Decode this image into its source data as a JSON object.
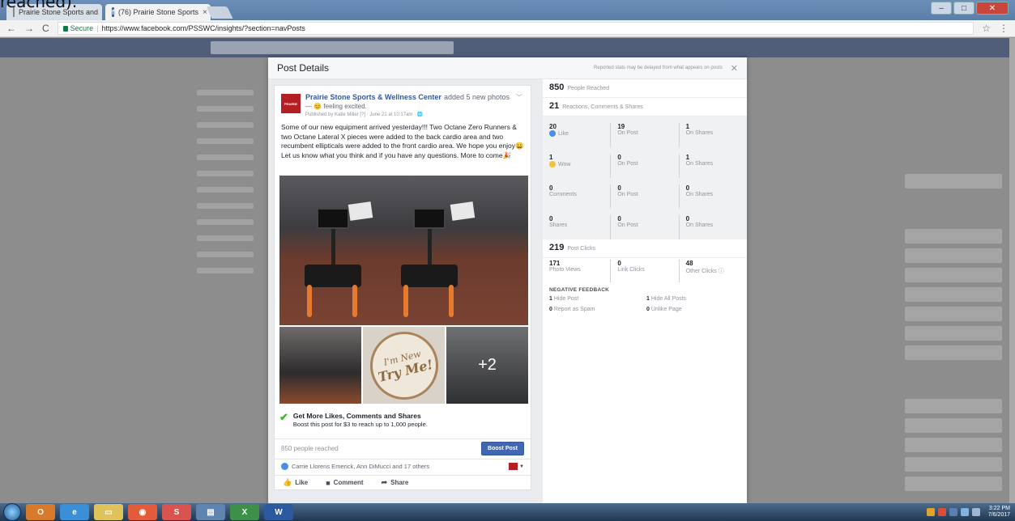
{
  "top_caption": "reached).",
  "browser": {
    "tabs": [
      {
        "title": "Prairie Stone Sports and",
        "active": false
      },
      {
        "title": "(76) Prairie Stone Sports",
        "active": true
      }
    ],
    "secure_label": "Secure",
    "url": "https://www.facebook.com/PSSWC/insights/?section=navPosts"
  },
  "modal": {
    "title": "Post Details",
    "note": "Reported stats may be delayed from what appears on posts"
  },
  "post": {
    "page_name": "Prairie Stone Sports & Wellness Center",
    "added_text": "added 5 new photos",
    "feeling": "— 😊 feeling excited.",
    "published": "Published by Katie Miller [?] · June 21 at 10:17am · 🌐",
    "body": "Some of our new equipment arrived yesterday!!! Two Octane Zero Runners & two Octane Lateral X pieces were added to the back cardio area and two recumbent ellipticals were added to the front cardio area. We hope you enjoy😀 Let us know what you think and if you have any questions. More to come🎉",
    "seal_top": "I'm New",
    "seal_main": "Try Me!",
    "more_photos": "+2",
    "boost_title": "Get More Likes, Comments and Shares",
    "boost_sub": "Boost this post for $3 to reach up to 1,000 people.",
    "reached": "850 people reached",
    "boost_button": "Boost Post",
    "reactors": "Carrie Llorens Emerick, Ann DiMucci and 17 others",
    "actions": {
      "like": "Like",
      "comment": "Comment",
      "share": "Share"
    }
  },
  "stats": {
    "reached": {
      "num": "850",
      "label": "People Reached"
    },
    "engagement": {
      "num": "21",
      "label": "Reactions, Comments & Shares"
    },
    "rows": [
      [
        {
          "n": "20",
          "l": "Like",
          "icon": "like"
        },
        {
          "n": "19",
          "l": "On Post"
        },
        {
          "n": "1",
          "l": "On Shares"
        }
      ],
      [
        {
          "n": "1",
          "l": "Wow",
          "icon": "wow"
        },
        {
          "n": "0",
          "l": "On Post"
        },
        {
          "n": "1",
          "l": "On Shares"
        }
      ],
      [
        {
          "n": "0",
          "l": "Comments"
        },
        {
          "n": "0",
          "l": "On Post"
        },
        {
          "n": "0",
          "l": "On Shares"
        }
      ],
      [
        {
          "n": "0",
          "l": "Shares"
        },
        {
          "n": "0",
          "l": "On Post"
        },
        {
          "n": "0",
          "l": "On Shares"
        }
      ]
    ],
    "clicks": {
      "num": "219",
      "label": "Post Clicks"
    },
    "click_cells": [
      {
        "n": "171",
        "l": "Photo Views"
      },
      {
        "n": "0",
        "l": "Link Clicks"
      },
      {
        "n": "48",
        "l": "Other Clicks ⓘ"
      }
    ],
    "negative_title": "NEGATIVE FEEDBACK",
    "negative": [
      {
        "n": "1",
        "l": "Hide Post"
      },
      {
        "n": "1",
        "l": "Hide All Posts"
      },
      {
        "n": "0",
        "l": "Report as Spam"
      },
      {
        "n": "0",
        "l": "Unlike Page"
      }
    ]
  },
  "taskbar": {
    "time": "3:22 PM",
    "date": "7/6/2017"
  }
}
